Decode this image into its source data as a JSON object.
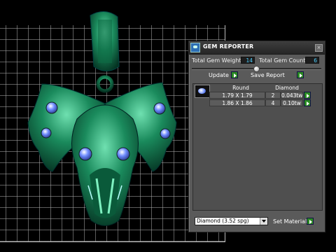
{
  "panel": {
    "title": "GEM REPORTER",
    "close_glyph": "×",
    "total_weight_label": "Total Gem Weight",
    "total_weight_value": "14",
    "total_count_label": "Total Gem Count",
    "total_count_value": "6",
    "update_label": "Update",
    "save_report_label": "Save Report",
    "table": {
      "header": [
        "Round",
        "Diamond"
      ],
      "rows": [
        {
          "size": "1.79 X 1.79",
          "count": "2",
          "weight": "0.043tw"
        },
        {
          "size": "1.86 X 1.86",
          "count": "4",
          "weight": "0.10tw"
        }
      ]
    },
    "material_select_value": "Diamond    (3.52 spg)",
    "set_material_label": "Set Material"
  },
  "colors": {
    "model_green": "#1a8a5c",
    "gem_blue": "#5a7cff",
    "panel_bg": "#5a5a5a",
    "button_arrow": "#2a8a22",
    "value_text": "#4fd0ff"
  },
  "icons": [
    "app-icon",
    "close-icon",
    "gem-thumbnail-icon",
    "arrow-right-icon",
    "dropdown-arrow-icon"
  ]
}
